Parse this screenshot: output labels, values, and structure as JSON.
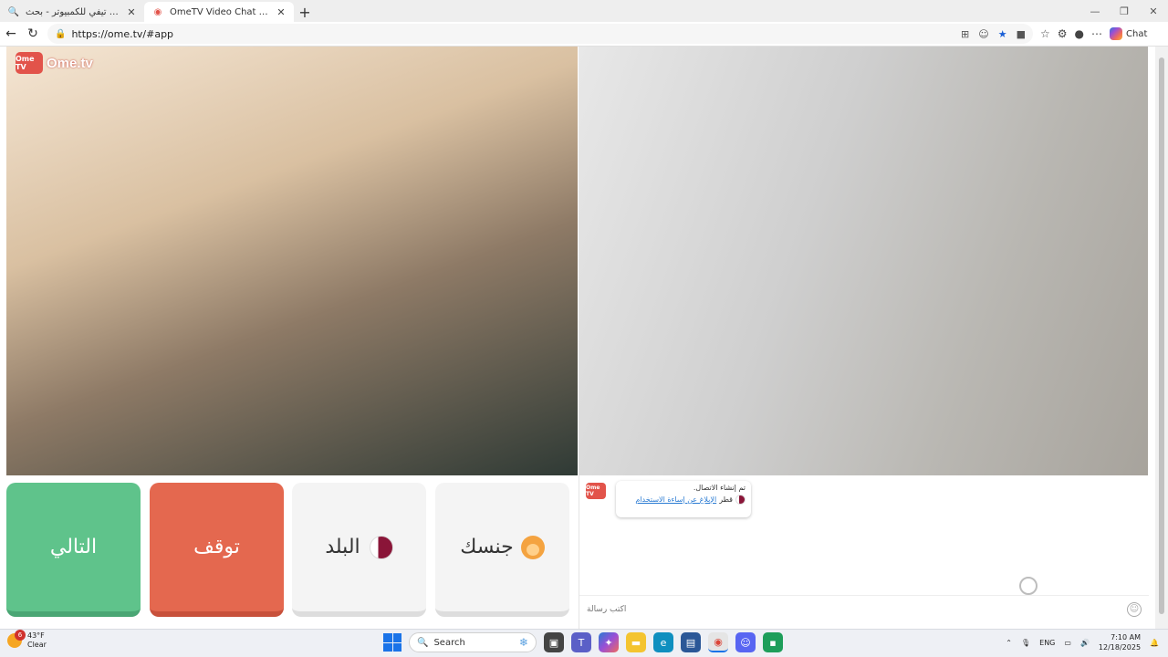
{
  "browser": {
    "tabs": [
      {
        "title": "اومي تيفي للكمبيوتر - بحث",
        "active": false,
        "icon": "search-icon"
      },
      {
        "title": "OmeTV Video Chat — Omegle",
        "active": true,
        "icon": "ometv-icon"
      }
    ],
    "new_tab": "+",
    "url": "https://ome.tv/#app",
    "chat_label": "Chat"
  },
  "app": {
    "logo_text": "Ome.tv",
    "logo_badge": "Ome TV",
    "buttons": {
      "next": "التالي",
      "stop": "توقف",
      "country": "البلد",
      "gender": "جنسك"
    },
    "chat": {
      "avatar_text": "Ome TV",
      "connection_message": "تم إنشاء الاتصال.",
      "country_name": "قطر",
      "report_link": "الإبلاغ عن إساءة الاستخدام",
      "input_placeholder": "اكتب رسالة"
    },
    "colors": {
      "next": "#5fc38b",
      "stop": "#e4684f",
      "brand": "#e2534a"
    }
  },
  "taskbar": {
    "weather_badge": "6",
    "temperature": "43°F",
    "condition": "Clear",
    "search_placeholder": "Search",
    "language": "ENG",
    "time": "7:10 AM",
    "date": "12/18/2025"
  }
}
